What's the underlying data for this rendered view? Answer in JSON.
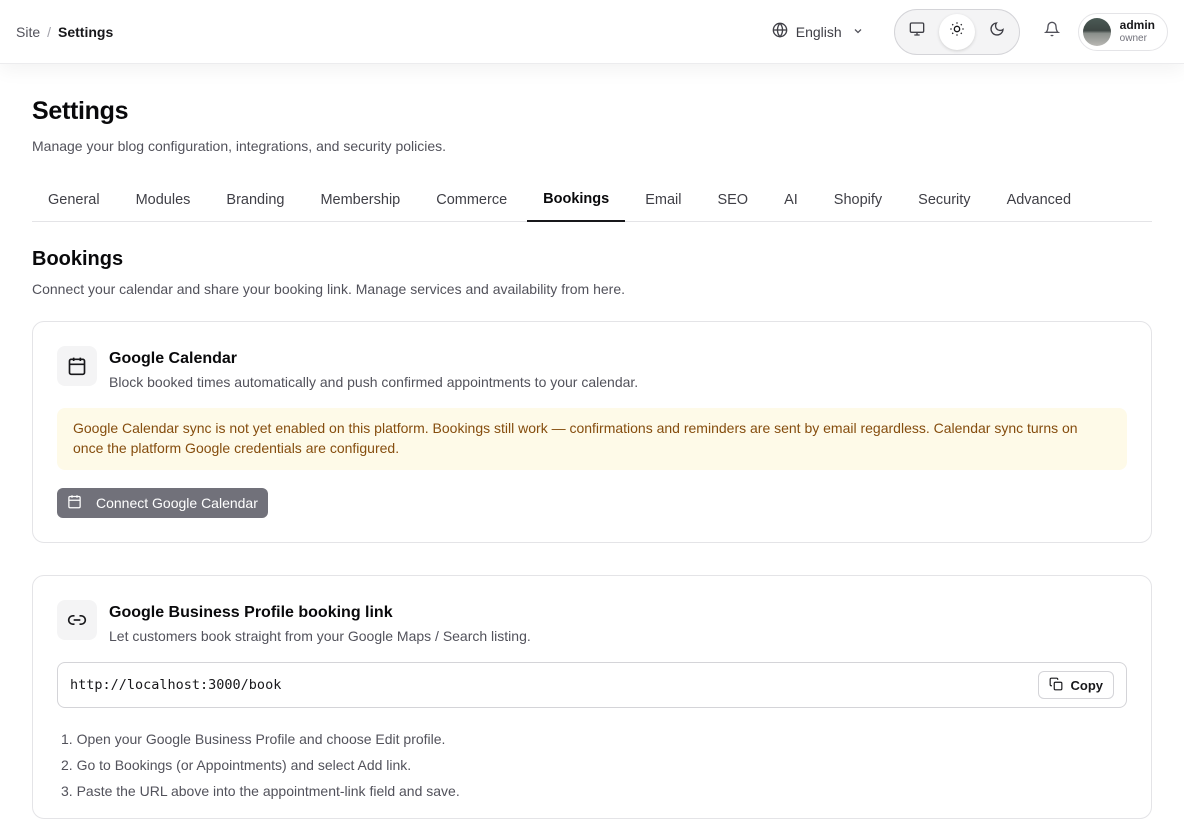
{
  "breadcrumb": {
    "site": "Site",
    "separator": "/",
    "current": "Settings"
  },
  "header": {
    "language": "English",
    "theme_options": [
      "system",
      "light",
      "dark"
    ],
    "theme_selected": "light",
    "user": {
      "name": "admin",
      "role": "owner"
    }
  },
  "page": {
    "title": "Settings",
    "subtitle": "Manage your blog configuration, integrations, and security policies."
  },
  "tabs": [
    {
      "label": "General",
      "active": false
    },
    {
      "label": "Modules",
      "active": false
    },
    {
      "label": "Branding",
      "active": false
    },
    {
      "label": "Membership",
      "active": false
    },
    {
      "label": "Commerce",
      "active": false
    },
    {
      "label": "Bookings",
      "active": true
    },
    {
      "label": "Email",
      "active": false
    },
    {
      "label": "SEO",
      "active": false
    },
    {
      "label": "AI",
      "active": false
    },
    {
      "label": "Shopify",
      "active": false
    },
    {
      "label": "Security",
      "active": false
    },
    {
      "label": "Advanced",
      "active": false
    }
  ],
  "section": {
    "title": "Bookings",
    "subtitle": "Connect your calendar and share your booking link. Manage services and availability from here."
  },
  "google_calendar": {
    "title": "Google Calendar",
    "description": "Block booked times automatically and push confirmed appointments to your calendar.",
    "notice": "Google Calendar sync is not yet enabled on this platform. Bookings still work — confirmations and reminders are sent by email regardless. Calendar sync turns on once the platform Google credentials are configured.",
    "button": "Connect Google Calendar"
  },
  "business_profile": {
    "title": "Google Business Profile booking link",
    "description": "Let customers book straight from your Google Maps / Search listing.",
    "url": "http://localhost:3000/book",
    "copy_label": "Copy",
    "steps": [
      "1. Open your Google Business Profile and choose Edit profile.",
      "2. Go to Bookings (or Appointments) and select Add link.",
      "3. Paste the URL above into the appointment-link field and save."
    ]
  },
  "colors": {
    "notice_bg": "#fefae8",
    "notice_text": "#854d0e",
    "button_disabled_bg": "#71717a"
  }
}
